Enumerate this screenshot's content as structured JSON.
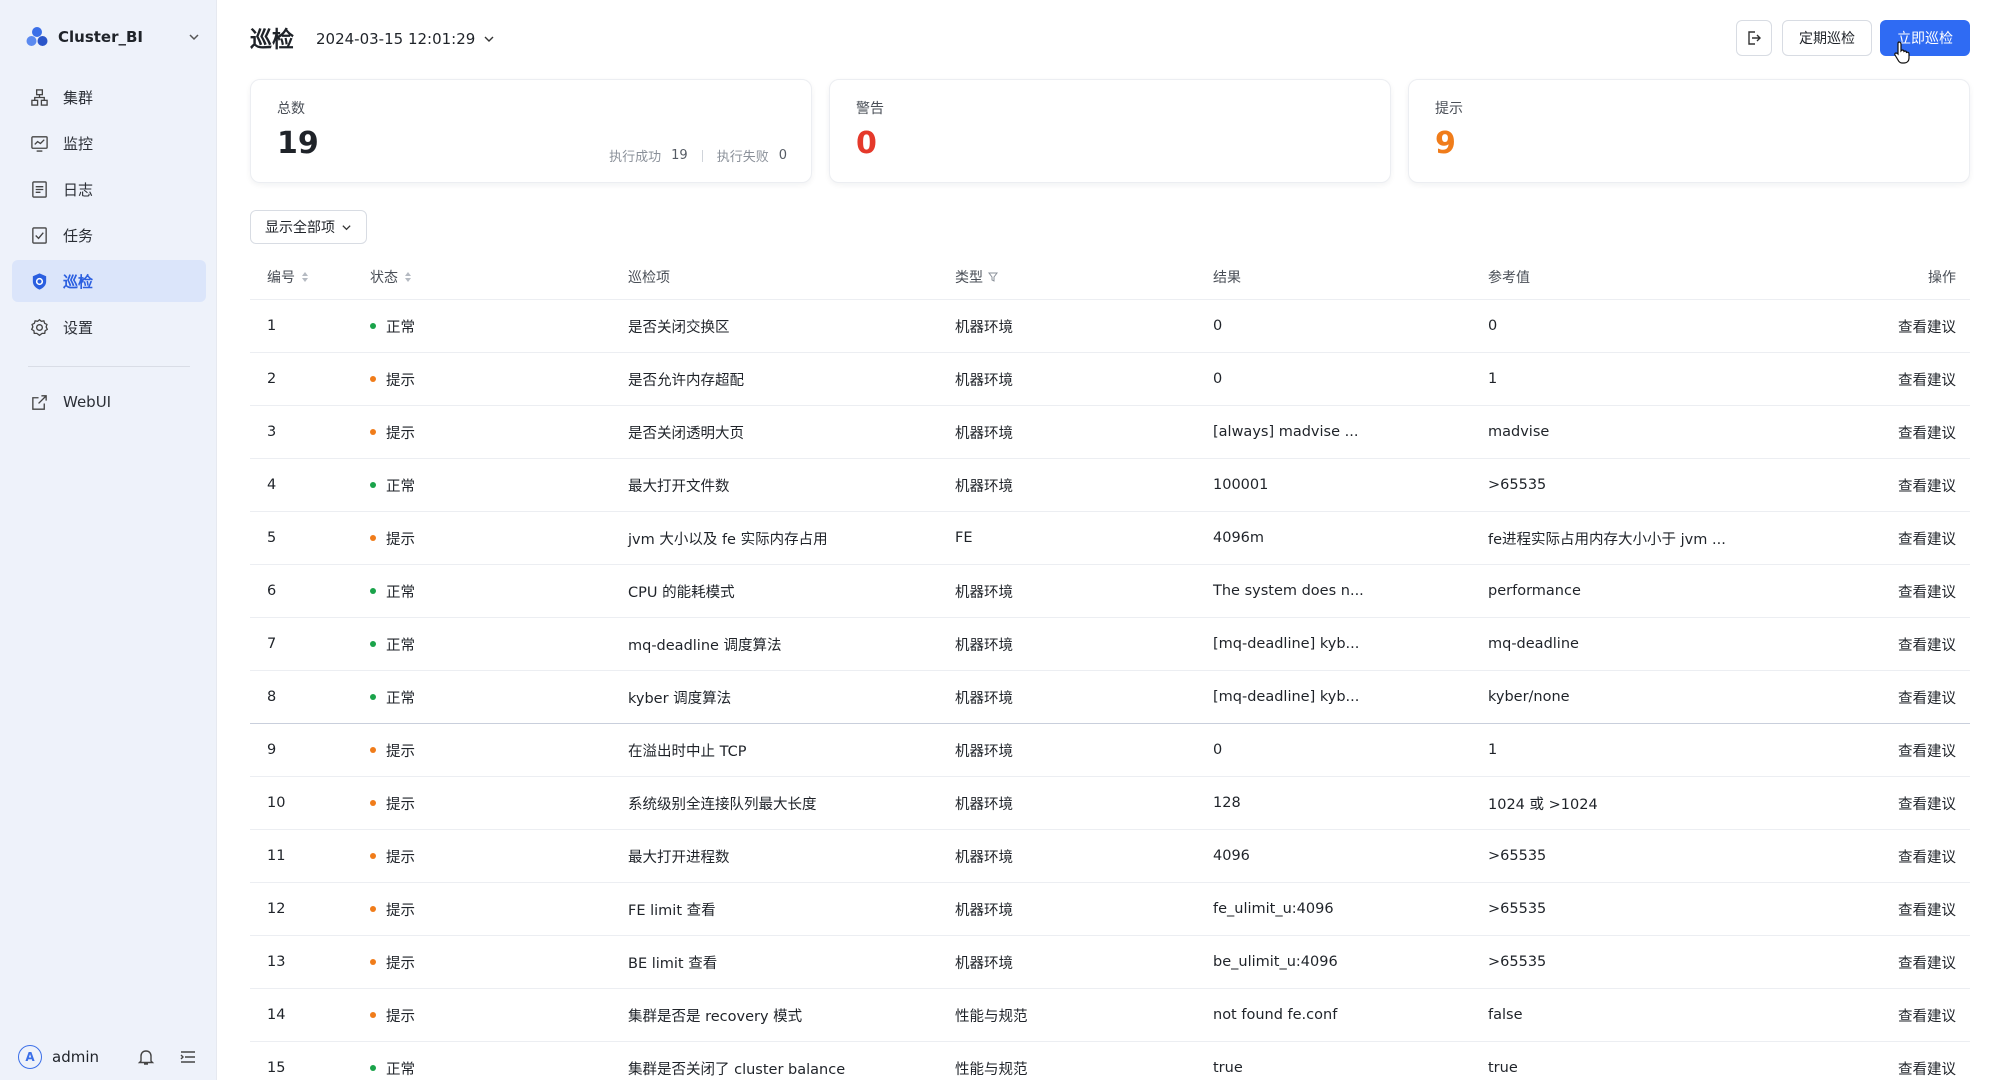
{
  "sidebar": {
    "cluster_name": "Cluster_BI",
    "items": [
      {
        "label": "集群",
        "icon": "cluster-icon",
        "active": false
      },
      {
        "label": "监控",
        "icon": "monitor-icon",
        "active": false
      },
      {
        "label": "日志",
        "icon": "log-icon",
        "active": false
      },
      {
        "label": "任务",
        "icon": "task-icon",
        "active": false
      },
      {
        "label": "巡检",
        "icon": "shield-icon",
        "active": true
      },
      {
        "label": "设置",
        "icon": "gear-icon",
        "active": false
      }
    ],
    "external": {
      "label": "WebUI",
      "icon": "external-link-icon"
    },
    "user": {
      "avatar": "A",
      "name": "admin"
    }
  },
  "header": {
    "title": "巡检",
    "datetime": "2024-03-15 12:01:29",
    "schedule_button": "定期巡检",
    "run_button": "立即巡检"
  },
  "cards": {
    "total": {
      "label": "总数",
      "value": "19",
      "success_label": "执行成功",
      "success_value": "19",
      "fail_label": "执行失败",
      "fail_value": "0"
    },
    "warning": {
      "label": "警告",
      "value": "0"
    },
    "hint": {
      "label": "提示",
      "value": "9"
    }
  },
  "colors": {
    "accent": "#2f6bf3",
    "normal": "#1aa34a",
    "hint": "#f07c1a",
    "warning": "#e5392b"
  },
  "filter": {
    "label": "显示全部项"
  },
  "table": {
    "headers": {
      "id": "编号",
      "status": "状态",
      "item": "巡检项",
      "type": "类型",
      "result": "结果",
      "reference": "参考值",
      "action": "操作"
    },
    "rows": [
      {
        "id": "1",
        "status": "正常",
        "level": "normal",
        "item": "是否关闭交换区",
        "type": "机器环境",
        "result": "0",
        "reference": "0",
        "action": "查看建议"
      },
      {
        "id": "2",
        "status": "提示",
        "level": "hint",
        "item": "是否允许内存超配",
        "type": "机器环境",
        "result": "0",
        "reference": "1",
        "action": "查看建议"
      },
      {
        "id": "3",
        "status": "提示",
        "level": "hint",
        "item": "是否关闭透明大页",
        "type": "机器环境",
        "result": "[always] madvise ...",
        "reference": "madvise",
        "action": "查看建议"
      },
      {
        "id": "4",
        "status": "正常",
        "level": "normal",
        "item": "最大打开文件数",
        "type": "机器环境",
        "result": "100001",
        "reference": ">65535",
        "action": "查看建议"
      },
      {
        "id": "5",
        "status": "提示",
        "level": "hint",
        "item": "jvm 大小以及 fe 实际内存占用",
        "type": "FE",
        "result": "4096m",
        "reference": "fe进程实际占用内存大小小于 jvm ...",
        "action": "查看建议"
      },
      {
        "id": "6",
        "status": "正常",
        "level": "normal",
        "item": "CPU 的能耗模式",
        "type": "机器环境",
        "result": "The system does n...",
        "reference": "performance",
        "action": "查看建议"
      },
      {
        "id": "7",
        "status": "正常",
        "level": "normal",
        "item": "mq-deadline 调度算法",
        "type": "机器环境",
        "result": "[mq-deadline] kyb...",
        "reference": "mq-deadline",
        "action": "查看建议"
      },
      {
        "id": "8",
        "status": "正常",
        "level": "normal",
        "item": "kyber 调度算法",
        "type": "机器环境",
        "result": "[mq-deadline] kyb...",
        "reference": "kyber/none",
        "action": "查看建议"
      },
      {
        "id": "9",
        "status": "提示",
        "level": "hint",
        "item": "在溢出时中止 TCP",
        "type": "机器环境",
        "result": "0",
        "reference": "1",
        "action": "查看建议"
      },
      {
        "id": "10",
        "status": "提示",
        "level": "hint",
        "item": "系统级别全连接队列最大长度",
        "type": "机器环境",
        "result": "128",
        "reference": "1024 或 >1024",
        "action": "查看建议"
      },
      {
        "id": "11",
        "status": "提示",
        "level": "hint",
        "item": "最大打开进程数",
        "type": "机器环境",
        "result": "4096",
        "reference": ">65535",
        "action": "查看建议"
      },
      {
        "id": "12",
        "status": "提示",
        "level": "hint",
        "item": "FE limit 查看",
        "type": "机器环境",
        "result": "fe_ulimit_u:4096",
        "reference": ">65535",
        "action": "查看建议"
      },
      {
        "id": "13",
        "status": "提示",
        "level": "hint",
        "item": "BE limit 查看",
        "type": "机器环境",
        "result": "be_ulimit_u:4096",
        "reference": ">65535",
        "action": "查看建议"
      },
      {
        "id": "14",
        "status": "提示",
        "level": "hint",
        "item": "集群是否是 recovery 模式",
        "type": "性能与规范",
        "result": "not found fe.conf",
        "reference": "false",
        "action": "查看建议"
      },
      {
        "id": "15",
        "status": "正常",
        "level": "normal",
        "item": "集群是否关闭了 cluster balance",
        "type": "性能与规范",
        "result": "true",
        "reference": "true",
        "action": "查看建议"
      }
    ]
  }
}
